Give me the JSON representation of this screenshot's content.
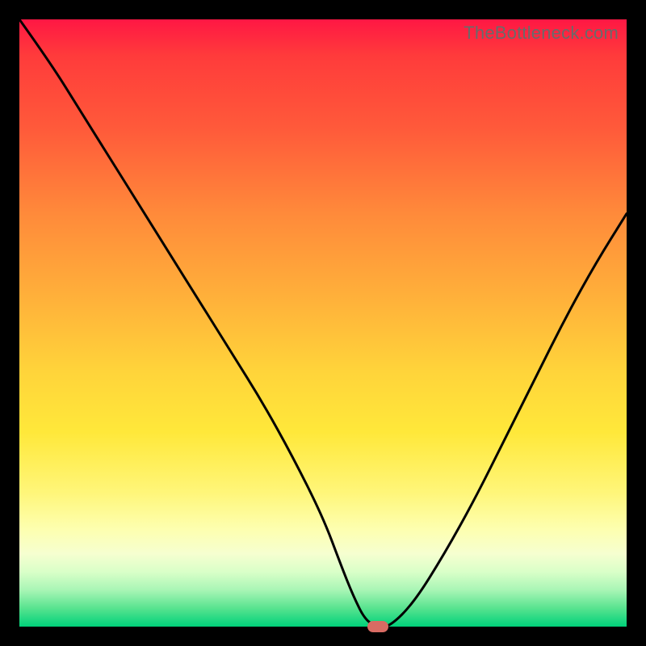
{
  "watermark": "TheBottleneck.com",
  "chart_data": {
    "type": "line",
    "title": "",
    "xlabel": "",
    "ylabel": "",
    "xlim": [
      0,
      100
    ],
    "ylim": [
      0,
      100
    ],
    "gradient_stops": [
      {
        "pos": 0,
        "color": "#ff1744"
      },
      {
        "pos": 6,
        "color": "#ff3b3b"
      },
      {
        "pos": 18,
        "color": "#ff5a3a"
      },
      {
        "pos": 32,
        "color": "#ff8a3a"
      },
      {
        "pos": 46,
        "color": "#ffb13a"
      },
      {
        "pos": 58,
        "color": "#ffd43a"
      },
      {
        "pos": 68,
        "color": "#ffe83a"
      },
      {
        "pos": 78,
        "color": "#fff67a"
      },
      {
        "pos": 84,
        "color": "#fdffb0"
      },
      {
        "pos": 88,
        "color": "#f6ffd0"
      },
      {
        "pos": 91,
        "color": "#d9ffc8"
      },
      {
        "pos": 94,
        "color": "#a8f5b5"
      },
      {
        "pos": 97,
        "color": "#57e38f"
      },
      {
        "pos": 100,
        "color": "#00d17a"
      }
    ],
    "series": [
      {
        "name": "bottleneck-curve",
        "x": [
          0,
          5,
          10,
          15,
          20,
          25,
          30,
          35,
          40,
          45,
          50,
          53,
          55,
          57,
          59,
          61,
          65,
          70,
          75,
          80,
          85,
          90,
          95,
          100
        ],
        "y": [
          100,
          93,
          85,
          77,
          69,
          61,
          53,
          45,
          37,
          28,
          18,
          10,
          5,
          1,
          0,
          0,
          4,
          12,
          21,
          31,
          41,
          51,
          60,
          68
        ]
      }
    ],
    "marker": {
      "x": 59,
      "y": 0,
      "color": "#d96b63"
    }
  }
}
